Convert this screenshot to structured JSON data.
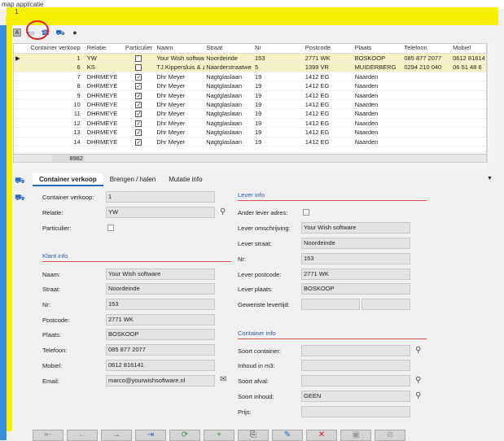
{
  "window": {
    "title": "map applicatie",
    "tab_number": "1"
  },
  "toolbar": {
    "a_label": "A",
    "icons": [
      "container-icon",
      "phone-icon",
      "truck-icon",
      "user-icon"
    ]
  },
  "grid": {
    "headers": [
      "Container verkoop",
      "Relatie",
      "Particulier",
      "Naam",
      "Straat",
      "Nr",
      "Postcode",
      "Plaats",
      "Telefoon",
      "Mobiel"
    ],
    "rows": [
      {
        "nr": "1",
        "relatie": "YW",
        "part": false,
        "naam": "Your Wish software",
        "straat": "Noordeinde",
        "huisnr": "153",
        "postcode": "2771 WK",
        "plaats": "BOSKOOP",
        "tel": "085 877 2077",
        "mob": "0612 81614"
      },
      {
        "nr": "6",
        "relatie": "KS",
        "part": false,
        "naam": "TJ.Kippersluis & z",
        "straat": "Naarderstraatwe",
        "huisnr": "5",
        "postcode": "1399 VR",
        "plaats": "MUIDERBERG",
        "tel": "0294 210 040",
        "mob": "06 51 48 6"
      },
      {
        "nr": "7",
        "relatie": "DHRMEYE",
        "part": true,
        "naam": "Dhr Meyer",
        "straat": "Nagtglaslaan",
        "huisnr": "19",
        "postcode": "1412 EG",
        "plaats": "Naarden",
        "tel": "",
        "mob": ""
      },
      {
        "nr": "8",
        "relatie": "DHRMEYE",
        "part": true,
        "naam": "Dhr Meyer",
        "straat": "Nagtglaslaan",
        "huisnr": "19",
        "postcode": "1412 EG",
        "plaats": "Naarden",
        "tel": "",
        "mob": ""
      },
      {
        "nr": "9",
        "relatie": "DHRMEYE",
        "part": true,
        "naam": "Dhr Meyer",
        "straat": "Nagtglaslaan",
        "huisnr": "19",
        "postcode": "1412 EG",
        "plaats": "Naarden",
        "tel": "",
        "mob": ""
      },
      {
        "nr": "10",
        "relatie": "DHRMEYE",
        "part": true,
        "naam": "Dhr Meyer",
        "straat": "Nagtglaslaan",
        "huisnr": "19",
        "postcode": "1412 EG",
        "plaats": "Naarden",
        "tel": "",
        "mob": ""
      },
      {
        "nr": "11",
        "relatie": "DHRMEYE",
        "part": true,
        "naam": "Dhr Meyer",
        "straat": "Nagtglaslaan",
        "huisnr": "19",
        "postcode": "1412 EG",
        "plaats": "Naarden",
        "tel": "",
        "mob": ""
      },
      {
        "nr": "12",
        "relatie": "DHRMEYE",
        "part": true,
        "naam": "Dhr Meyer",
        "straat": "Nagtglaslaan",
        "huisnr": "19",
        "postcode": "1412 EG",
        "plaats": "Naarden",
        "tel": "",
        "mob": ""
      },
      {
        "nr": "13",
        "relatie": "DHRMEYE",
        "part": true,
        "naam": "Dhr Meyer",
        "straat": "Nagtglaslaan",
        "huisnr": "19",
        "postcode": "1412 EG",
        "plaats": "Naarden",
        "tel": "",
        "mob": ""
      },
      {
        "nr": "14",
        "relatie": "DHRMEYE",
        "part": true,
        "naam": "Dhr Meyer",
        "straat": "Nagtglaslaan",
        "huisnr": "19",
        "postcode": "1412 EG",
        "plaats": "Naarden",
        "tel": "",
        "mob": ""
      }
    ],
    "footer_count": "8982"
  },
  "tabs": [
    "Container verkoop",
    "Brengen / halen",
    "Mutatie info"
  ],
  "form": {
    "container_verkoop_label": "Container verkoop:",
    "container_verkoop": "1",
    "relatie_label": "Relatie:",
    "relatie": "YW",
    "particulier_label": "Particulier:",
    "klant_info": "Klant info",
    "naam_label": "Naam:",
    "naam": "Your Wish software",
    "straat_label": "Straat:",
    "straat": "Noordeinde",
    "nr_label": "Nr:",
    "nr": "153",
    "postcode_label": "Postcode:",
    "postcode": "2771 WK",
    "plaats_label": "Plaats:",
    "plaats": "BOSKOOP",
    "telefoon_label": "Telefoon:",
    "telefoon": "085 877 2077",
    "mobiel_label": "Mobiel:",
    "mobiel": "0612 816141",
    "email_label": "Email:",
    "email": "marco@yourwishsoftware.nl",
    "lever_info": "Lever info",
    "ander_lever_label": "Ander lever adres:",
    "lever_omschrijving_label": "Lever omschrijving:",
    "lever_omschrijving": "Your Wish software",
    "lever_straat_label": "Lever straat:",
    "lever_straat": "Noordeinde",
    "lever_nr_label": "Nr:",
    "lever_nr": "153",
    "lever_postcode_label": "Lever postcode:",
    "lever_postcode": "2771 WK",
    "lever_plaats_label": "Lever plaats:",
    "lever_plaats": "BOSKOOP",
    "levertijd_label": "Gewenste levertijd:",
    "container_info": "Container info",
    "soort_container_label": "Soort container:",
    "inhoud_label": "Inhoud in m3:",
    "soort_afval_label": "Soort afval:",
    "soort_inhoud_label": "Soort inhoud:",
    "soort_inhoud": "GEEN",
    "prijs_label": "Prijs:"
  },
  "bottom_toolbar": [
    "first-icon",
    "prev-icon",
    "next-icon",
    "last-icon",
    "refresh-icon",
    "add-icon",
    "copy-icon",
    "edit-icon",
    "delete-icon",
    "save-icon",
    "cancel-icon"
  ]
}
